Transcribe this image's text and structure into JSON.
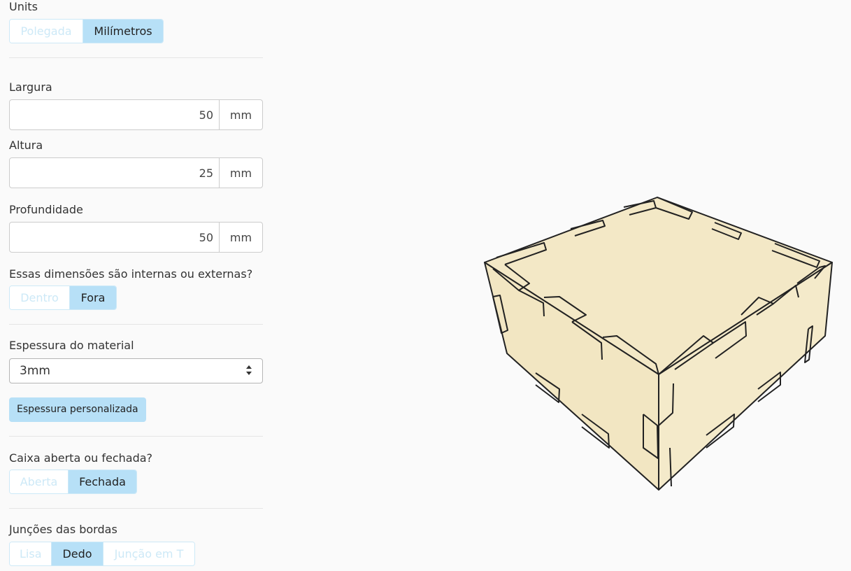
{
  "units": {
    "label": "Units",
    "options": [
      "Polegada",
      "Milímetros"
    ],
    "selected": "Milímetros"
  },
  "width": {
    "label": "Largura",
    "value": "50",
    "unit": "mm"
  },
  "height": {
    "label": "Altura",
    "value": "25",
    "unit": "mm"
  },
  "depth": {
    "label": "Profundidade",
    "value": "50",
    "unit": "mm"
  },
  "dimensions_mode": {
    "label": "Essas dimensões são internas ou externas?",
    "options": [
      "Dentro",
      "Fora"
    ],
    "selected": "Fora"
  },
  "material": {
    "label": "Espessura do material",
    "selected": "3mm",
    "custom_button": "Espessura personalizada"
  },
  "box_type": {
    "label": "Caixa aberta ou fechada?",
    "options": [
      "Aberta",
      "Fechada"
    ],
    "selected": "Fechada"
  },
  "joints": {
    "label": "Junções das bordas",
    "options": [
      "Lisa",
      "Dedo",
      "Junção em T"
    ],
    "selected": "Dedo"
  },
  "colors": {
    "accent": "#b7e0f7",
    "accent_border": "#cde9f7",
    "wood": "#f3e8c6",
    "outline": "#222222"
  }
}
